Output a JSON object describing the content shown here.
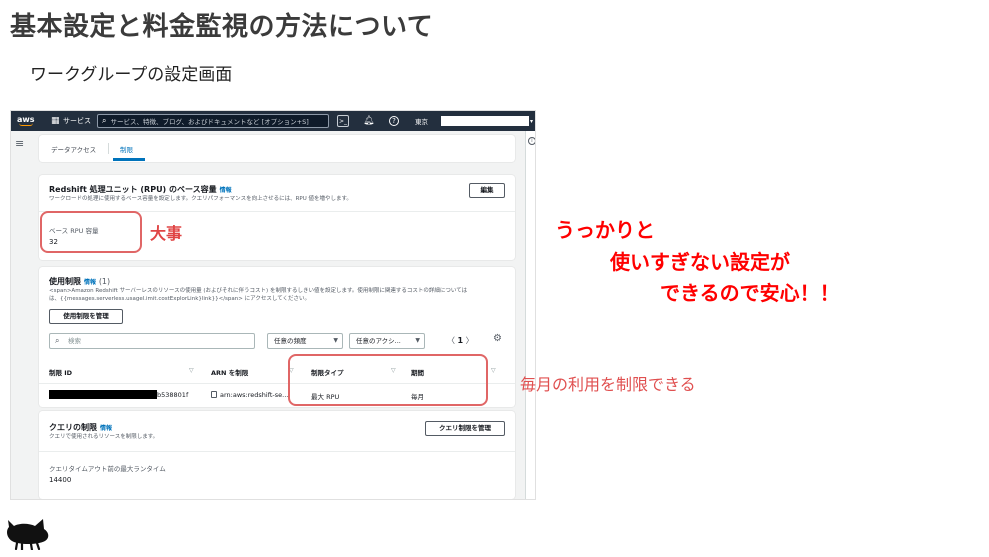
{
  "slide": {
    "title": "基本設定と料金監視の方法について",
    "subtitle": "ワークグループの設定画面"
  },
  "console": {
    "topnav": {
      "logo": "aws",
      "services_label": "サービス",
      "search_placeholder": "サービス、特徴、ブログ、およびドキュメントなど [オプション+S]",
      "region": "東京"
    },
    "tabs": [
      {
        "label": "データアクセス"
      },
      {
        "label": "制限"
      }
    ],
    "rpu_section": {
      "title": "Redshift 処理ユニット (RPU) のベース容量",
      "info": "情報",
      "description": "ワークロードの処理に使用するベース容量を設定します。クエリパフォーマンスを向上させるには、RPU 値を増やします。",
      "edit_button": "編集",
      "field_label": "ベース RPU 容量",
      "field_value": "32"
    },
    "usage_section": {
      "title": "使用制限",
      "info": "情報",
      "count": "(1)",
      "description_line1": "<span>Amazon Redshift サーバーレスのリソースの使用量 (およびそれに伴うコスト) を制限するしきい値を設定します。使用制限に関連するコストの詳細については",
      "description_line2": "は、{{messages.serverless.usagel.imit.costExplorLink}link}}</span> にアクセスしてください。",
      "manage_button": "使用制限を管理",
      "search_placeholder": "検索",
      "filter_frequency": "任意の頻度",
      "filter_action": "任意のアクシ...",
      "page": "1",
      "columns": [
        "制限 ID",
        "ARN を制限",
        "制限タイプ",
        "期間"
      ],
      "rows": [
        {
          "id_suffix": "b538801f",
          "arn": "arn:aws:redshift-se...",
          "type": "最大 RPU",
          "period": "毎月"
        }
      ]
    },
    "query_section": {
      "title": "クエリの制限",
      "info": "情報",
      "description": "クエリで使用されるリソースを制限します。",
      "manage_button": "クエリ制限を管理",
      "field_label": "クエリタイムアウト前の最大ランタイム",
      "field_value": "14400"
    }
  },
  "annotations": {
    "important": "大事",
    "monthly_note": "毎月の利用を制限できる",
    "lines": [
      "うっかりと",
      "使いすぎない設定が",
      "できるので安心！！"
    ]
  },
  "colors": {
    "annotation_red": "#ff0000",
    "highlight_box": "#e06666",
    "aws_nav": "#232f3e",
    "aws_orange": "#ff9900",
    "link_blue": "#0073bb"
  }
}
